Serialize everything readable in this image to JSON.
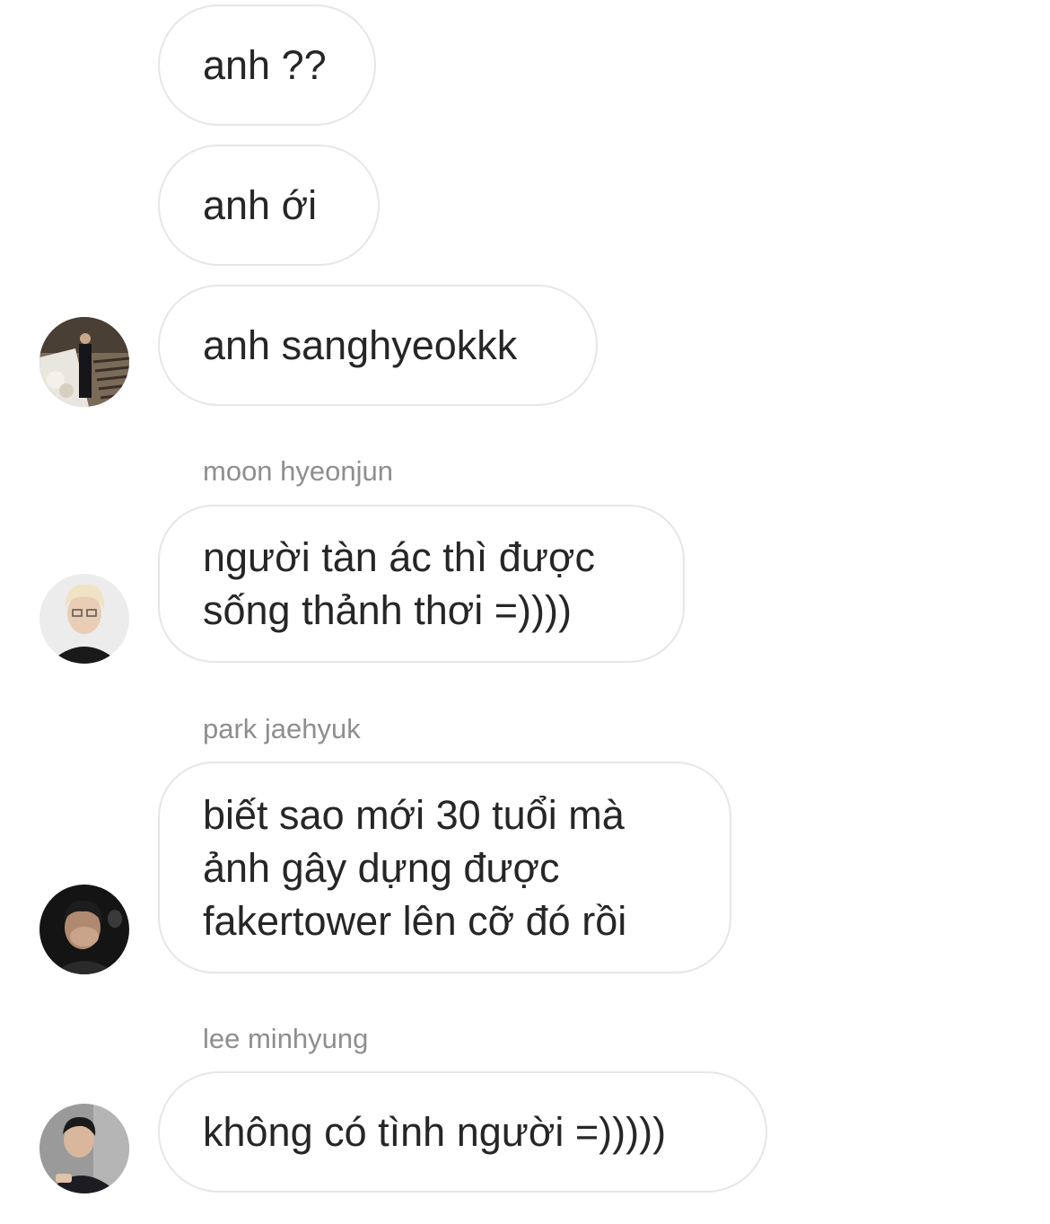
{
  "messages": [
    {
      "text": "anh ??"
    },
    {
      "text": "anh ới"
    },
    {
      "text": "anh sanghyeokkk"
    }
  ],
  "groups": [
    {
      "sender": "moon hyeonjun",
      "text": "người tàn ác thì được\nsống thảnh thơi =))))"
    },
    {
      "sender": "park jaehyuk",
      "text": "biết sao mới 30 tuổi mà\nảnh gây dựng được\nfakertower lên cỡ đó rồi"
    },
    {
      "sender": "lee minhyung",
      "text": "không có tình người =)))))"
    }
  ],
  "avatars": [
    {
      "icon": "avatar-photo-stairs"
    },
    {
      "icon": "avatar-photo-blond"
    },
    {
      "icon": "avatar-photo-dark"
    },
    {
      "icon": "avatar-photo-suit"
    }
  ],
  "colors": {
    "bubble_border": "#e6e6e6",
    "text": "#262626",
    "sender": "#8e8e8e"
  }
}
